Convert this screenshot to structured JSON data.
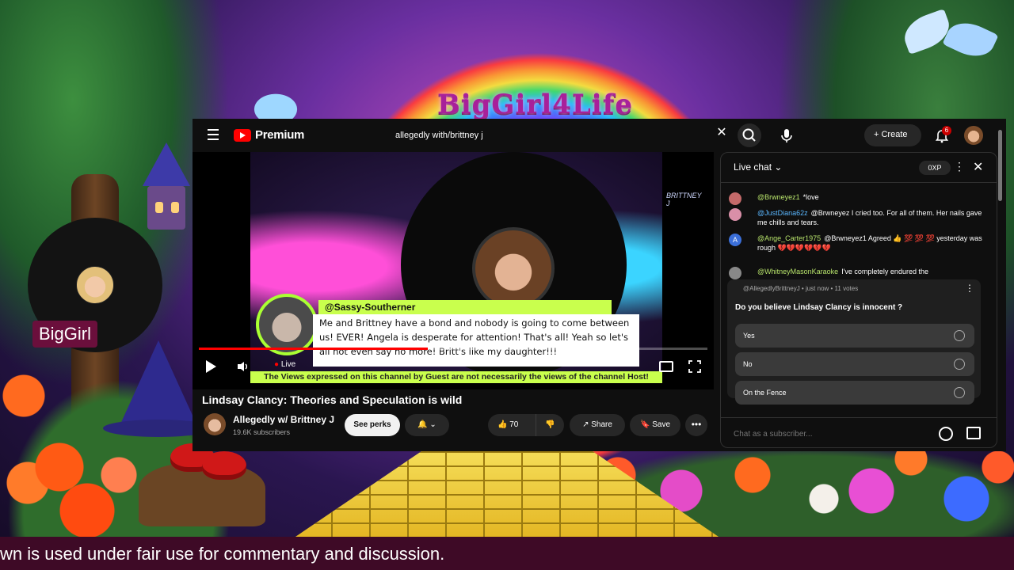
{
  "overlay": {
    "brand_title": "BigGirl4Life",
    "cam_name": "BigGirl",
    "banner_text": "wn is used under fair use for commentary and discussion."
  },
  "youtube": {
    "brand": "Premium",
    "search": {
      "value": "allegedly with/brittney j"
    },
    "create_label": "Create",
    "notification_count": "6",
    "video": {
      "title": "Lindsay Clancy: Theories and Speculation is wild",
      "live_label": "Live",
      "watermark": "BRITTNEY J",
      "progress": 0.45,
      "card": {
        "handle": "@Sassy-Southerner",
        "text": "Me and Brittney have a bond and nobody is going to come between us! EVER! Angela is desperate for attention! That's all! Yeah so let's all not even say no more! Britt's like my daughter!!!"
      },
      "disclaimer": "The Views expressed on this channel by Guest are not necessarily the views of the channel Host!"
    },
    "channel": {
      "name": "Allegedly w/ Brittney J",
      "subscribers": "19.6K subscribers",
      "perks_label": "See perks"
    },
    "actions": {
      "likes": "70",
      "share_label": "Share",
      "save_label": "Save"
    },
    "chat": {
      "title": "Live chat",
      "pill": "0XP",
      "messages": [
        {
          "author": "@Brwneyez1",
          "text": "*love",
          "color": "#b7e36b",
          "avatar": "#c46a6a"
        },
        {
          "author": "@JustDiana62z",
          "text": "@Brwneyez I cried too. For all of them. Her nails gave me chills and tears.",
          "color": "#5ab7ff",
          "avatar": "#d98fa8"
        },
        {
          "author": "@Ange_Carter1975",
          "text": "@Brwneyez1 Agreed 👍 💯 💯 💯 yesterday was rough 💔💔💔💔💔💔",
          "color": "#b7e36b",
          "avatar": "#3b6fd9",
          "initial": "A"
        },
        {
          "author": "@WhitneyMasonKaraoke",
          "text": "I've completely endured the",
          "color": "#b7e36b",
          "avatar": "#888888"
        }
      ],
      "poll": {
        "meta": "@AllegedlyBrittneyJ • just now • 11 votes",
        "question": "Do you believe Lindsay Clancy is innocent ?",
        "options": [
          "Yes",
          "No",
          "On the Fence"
        ]
      },
      "input_placeholder": "Chat as a subscriber..."
    }
  }
}
